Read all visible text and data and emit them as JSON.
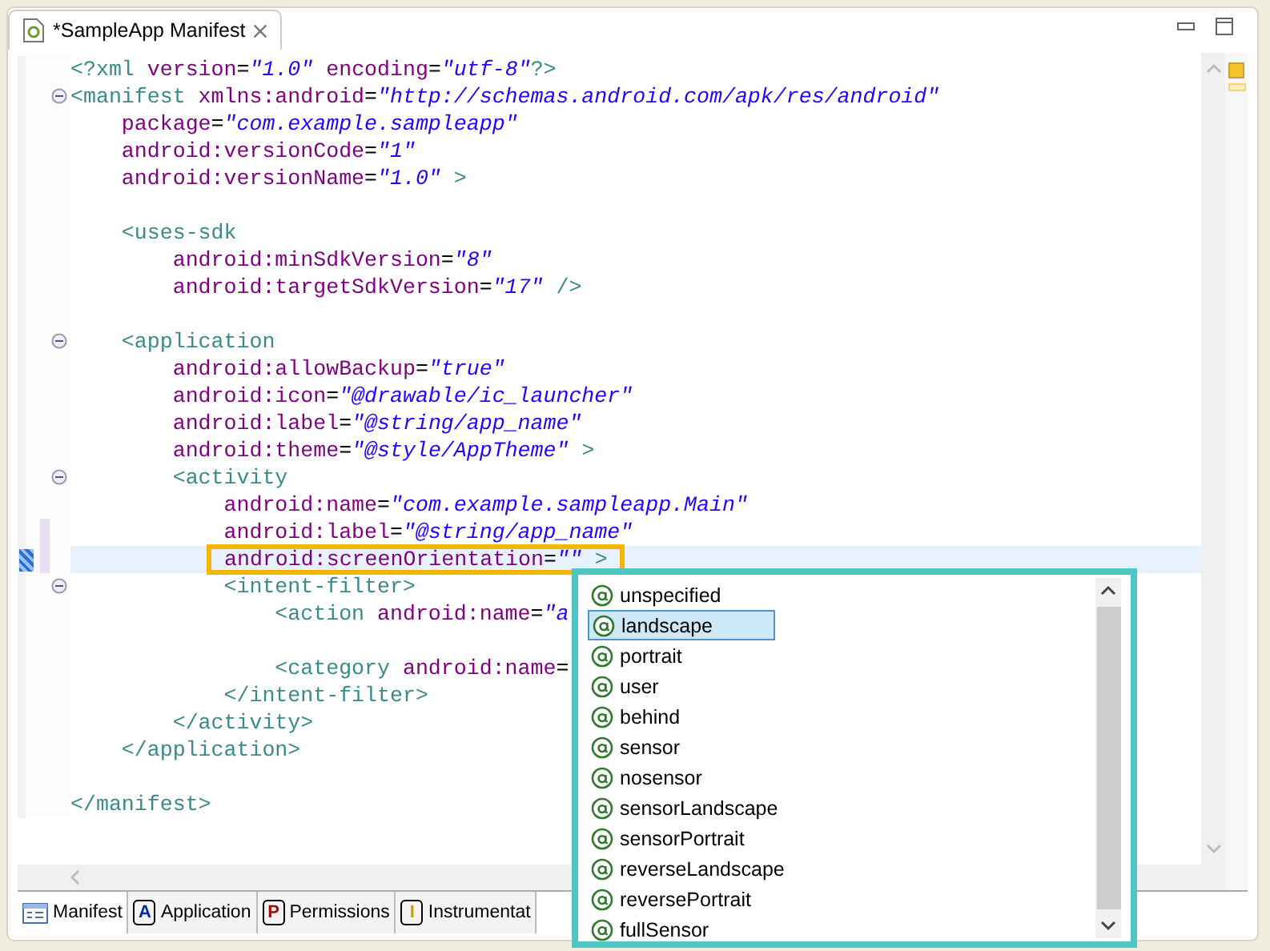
{
  "editor_tab": {
    "title": "*SampleApp Manifest"
  },
  "lines": [
    {
      "kind": "code",
      "fold": false,
      "changed": false,
      "current": false,
      "segments": [
        {
          "text": "<?xml ",
          "kind": "tag"
        },
        {
          "text": "version",
          "kind": "attr"
        },
        {
          "text": "=",
          "kind": "plain"
        },
        {
          "text": "\"1.0\"",
          "kind": "value"
        },
        {
          "text": " encoding",
          "kind": "attr"
        },
        {
          "text": "=",
          "kind": "plain"
        },
        {
          "text": "\"utf-8\"",
          "kind": "value"
        },
        {
          "text": "?>",
          "kind": "tag"
        }
      ]
    },
    {
      "kind": "code",
      "fold": true,
      "changed": false,
      "current": false,
      "segments": [
        {
          "text": "<manifest ",
          "kind": "tag"
        },
        {
          "text": "xmlns:android",
          "kind": "attr"
        },
        {
          "text": "=",
          "kind": "plain"
        },
        {
          "text": "\"http://schemas.android.com/apk/res/android\"",
          "kind": "value"
        }
      ]
    },
    {
      "kind": "code",
      "fold": false,
      "changed": false,
      "current": false,
      "segments": [
        {
          "text": "    package",
          "kind": "attr"
        },
        {
          "text": "=",
          "kind": "plain"
        },
        {
          "text": "\"com.example.sampleapp\"",
          "kind": "value"
        }
      ]
    },
    {
      "kind": "code",
      "fold": false,
      "changed": false,
      "current": false,
      "segments": [
        {
          "text": "    android:versionCode",
          "kind": "attr"
        },
        {
          "text": "=",
          "kind": "plain"
        },
        {
          "text": "\"1\"",
          "kind": "value"
        }
      ]
    },
    {
      "kind": "code",
      "fold": false,
      "changed": false,
      "current": false,
      "segments": [
        {
          "text": "    android:versionName",
          "kind": "attr"
        },
        {
          "text": "=",
          "kind": "plain"
        },
        {
          "text": "\"1.0\"",
          "kind": "value"
        },
        {
          "text": " >",
          "kind": "tag"
        }
      ]
    },
    {
      "kind": "blank"
    },
    {
      "kind": "code",
      "fold": false,
      "changed": false,
      "current": false,
      "segments": [
        {
          "text": "    <uses-sdk",
          "kind": "tag"
        }
      ]
    },
    {
      "kind": "code",
      "fold": false,
      "changed": false,
      "current": false,
      "segments": [
        {
          "text": "        android:minSdkVersion",
          "kind": "attr"
        },
        {
          "text": "=",
          "kind": "plain"
        },
        {
          "text": "\"8\"",
          "kind": "value"
        }
      ]
    },
    {
      "kind": "code",
      "fold": false,
      "changed": false,
      "current": false,
      "segments": [
        {
          "text": "        android:targetSdkVersion",
          "kind": "attr"
        },
        {
          "text": "=",
          "kind": "plain"
        },
        {
          "text": "\"17\"",
          "kind": "value"
        },
        {
          "text": " />",
          "kind": "tag"
        }
      ]
    },
    {
      "kind": "blank"
    },
    {
      "kind": "code",
      "fold": true,
      "changed": false,
      "current": false,
      "segments": [
        {
          "text": "    <application",
          "kind": "tag"
        }
      ]
    },
    {
      "kind": "code",
      "fold": false,
      "changed": false,
      "current": false,
      "segments": [
        {
          "text": "        android:allowBackup",
          "kind": "attr"
        },
        {
          "text": "=",
          "kind": "plain"
        },
        {
          "text": "\"true\"",
          "kind": "value"
        }
      ]
    },
    {
      "kind": "code",
      "fold": false,
      "changed": false,
      "current": false,
      "segments": [
        {
          "text": "        android:icon",
          "kind": "attr"
        },
        {
          "text": "=",
          "kind": "plain"
        },
        {
          "text": "\"@drawable/ic_launcher\"",
          "kind": "value"
        }
      ]
    },
    {
      "kind": "code",
      "fold": false,
      "changed": false,
      "current": false,
      "segments": [
        {
          "text": "        android:label",
          "kind": "attr"
        },
        {
          "text": "=",
          "kind": "plain"
        },
        {
          "text": "\"@string/app_name\"",
          "kind": "value"
        }
      ]
    },
    {
      "kind": "code",
      "fold": false,
      "changed": false,
      "current": false,
      "segments": [
        {
          "text": "        android:theme",
          "kind": "attr"
        },
        {
          "text": "=",
          "kind": "plain"
        },
        {
          "text": "\"@style/AppTheme\"",
          "kind": "value"
        },
        {
          "text": " >",
          "kind": "tag"
        }
      ]
    },
    {
      "kind": "code",
      "fold": true,
      "changed": false,
      "current": false,
      "segments": [
        {
          "text": "        <activity",
          "kind": "tag"
        }
      ]
    },
    {
      "kind": "code",
      "fold": false,
      "changed": false,
      "current": false,
      "segments": [
        {
          "text": "            android:name",
          "kind": "attr"
        },
        {
          "text": "=",
          "kind": "plain"
        },
        {
          "text": "\"com.example.sampleapp.Main\"",
          "kind": "value"
        }
      ]
    },
    {
      "kind": "code",
      "fold": false,
      "changed": true,
      "current": false,
      "segments": [
        {
          "text": "            android:label",
          "kind": "attr"
        },
        {
          "text": "=",
          "kind": "plain"
        },
        {
          "text": "\"@string/app_name\"",
          "kind": "value"
        }
      ]
    },
    {
      "kind": "code",
      "fold": false,
      "changed": true,
      "current": true,
      "segments": [
        {
          "text": "android:screenOrientation",
          "kind": "attr"
        },
        {
          "text": "=",
          "kind": "plain"
        },
        {
          "text": "\"\"",
          "kind": "value"
        },
        {
          "text": " >",
          "kind": "tag"
        }
      ]
    },
    {
      "kind": "code",
      "fold": true,
      "changed": false,
      "current": false,
      "segments": [
        {
          "text": "            <intent-filter>",
          "kind": "tag"
        }
      ]
    },
    {
      "kind": "code",
      "fold": false,
      "changed": false,
      "current": false,
      "segments": [
        {
          "text": "                <action ",
          "kind": "tag"
        },
        {
          "text": "android:name",
          "kind": "attr"
        },
        {
          "text": "=",
          "kind": "plain"
        },
        {
          "text": "\"a",
          "kind": "value"
        }
      ]
    },
    {
      "kind": "blank"
    },
    {
      "kind": "code",
      "fold": false,
      "changed": false,
      "current": false,
      "segments": [
        {
          "text": "                <category ",
          "kind": "tag"
        },
        {
          "text": "android:name",
          "kind": "attr"
        },
        {
          "text": "=",
          "kind": "plain"
        }
      ]
    },
    {
      "kind": "code",
      "fold": false,
      "changed": false,
      "current": false,
      "segments": [
        {
          "text": "            </intent-filter>",
          "kind": "tag"
        }
      ]
    },
    {
      "kind": "code",
      "fold": false,
      "changed": false,
      "current": false,
      "segments": [
        {
          "text": "        </activity>",
          "kind": "tag"
        }
      ]
    },
    {
      "kind": "code",
      "fold": false,
      "changed": false,
      "current": false,
      "segments": [
        {
          "text": "    </application>",
          "kind": "tag"
        }
      ]
    },
    {
      "kind": "blank"
    },
    {
      "kind": "code",
      "fold": false,
      "changed": false,
      "current": false,
      "segments": [
        {
          "text": "</manifest>",
          "kind": "tag"
        }
      ]
    }
  ],
  "completion": {
    "items": [
      {
        "label": "unspecified",
        "selected": false
      },
      {
        "label": "landscape",
        "selected": true
      },
      {
        "label": "portrait",
        "selected": false
      },
      {
        "label": "user",
        "selected": false
      },
      {
        "label": "behind",
        "selected": false
      },
      {
        "label": "sensor",
        "selected": false
      },
      {
        "label": "nosensor",
        "selected": false
      },
      {
        "label": "sensorLandscape",
        "selected": false
      },
      {
        "label": "sensorPortrait",
        "selected": false
      },
      {
        "label": "reverseLandscape",
        "selected": false
      },
      {
        "label": "reversePortrait",
        "selected": false
      },
      {
        "label": "fullSensor",
        "selected": false
      }
    ]
  },
  "bottom_tabs": [
    {
      "label": "Manifest",
      "kind": "list",
      "selected": true
    },
    {
      "label": "Application",
      "kind": "letter",
      "letter": "A",
      "selected": false
    },
    {
      "label": "Permissions",
      "kind": "letter",
      "letter": "P",
      "selected": false
    },
    {
      "label": "Instrumentat",
      "kind": "letter",
      "letter": "I",
      "selected": false
    }
  ]
}
